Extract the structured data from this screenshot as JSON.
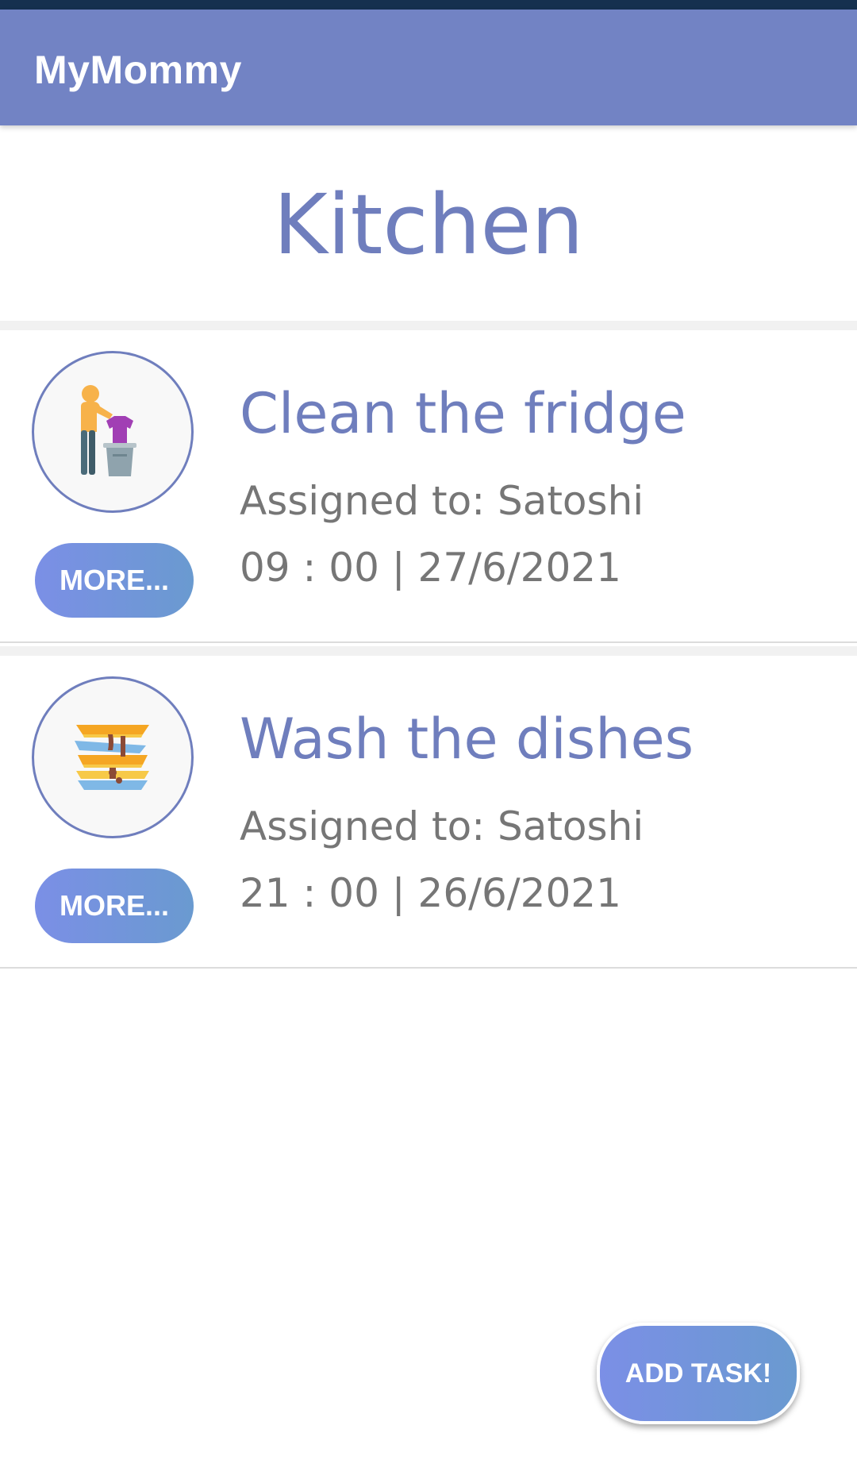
{
  "app_bar": {
    "title": "MyMommy",
    "color": "#7283c4"
  },
  "page": {
    "title": "Kitchen"
  },
  "tasks": [
    {
      "title": "Clean the fridge",
      "assigned": "Assigned to: Satoshi",
      "when": "09 : 00 | 27/6/2021",
      "icon": "laundry-icon",
      "more_label": "MORE..."
    },
    {
      "title": "Wash the dishes",
      "assigned": "Assigned to: Satoshi",
      "when": "21 : 00 | 26/6/2021",
      "icon": "dishes-icon",
      "more_label": "MORE..."
    }
  ],
  "fab": {
    "label": "ADD TASK!"
  },
  "colors": {
    "accent": "#6f7ebd",
    "button_gradient_start": "#7b8fe6",
    "button_gradient_end": "#6a9ad0",
    "status_bar": "#15304f"
  }
}
